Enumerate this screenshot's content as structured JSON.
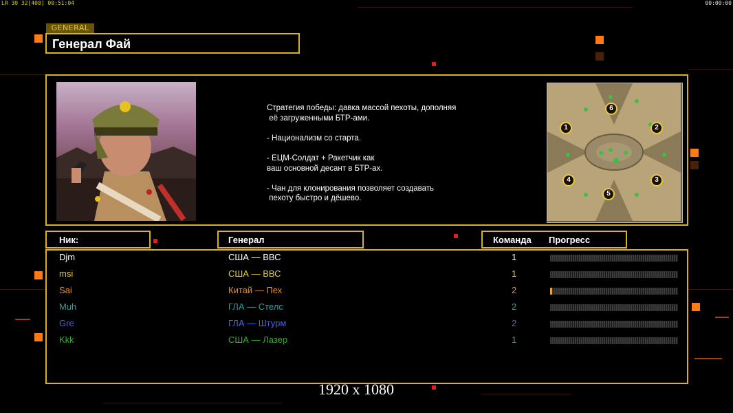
{
  "hud": {
    "left_stats": "LR 30 32[400] 00:51:04",
    "right_time": "00:00:00"
  },
  "general_tag": "GENERAL",
  "title": "Генерал Фай",
  "description": "Стратегия победы: давка массой пехоты, дополняя\n её загруженными БТР-ами.\n\n- Национализм со старта.\n\n- ЕЦМ-Солдат + Ракетчик как\nваш основной десант в БТР-ах.\n\n- Чан для клонирования позволяет создавать\n пехоту быстро и дёшево.",
  "minimap": {
    "markers": [
      "1",
      "2",
      "3",
      "4",
      "5",
      "6"
    ]
  },
  "columns": {
    "nick": "Ник:",
    "general": "Генерал",
    "team": "Команда",
    "progress": "Прогресс"
  },
  "players": [
    {
      "nick": "Djm",
      "general": "США — ВВС",
      "team": "1",
      "progress": 0,
      "color": "#ffffff"
    },
    {
      "nick": "msi",
      "general": "США — ВВС",
      "team": "1",
      "progress": 0,
      "color": "#e8d020"
    },
    {
      "nick": "Sai",
      "general": "Китай — Пех",
      "team": "2",
      "progress": 0.015,
      "color": "#f08c2c"
    },
    {
      "nick": "Muh",
      "general": "ГЛА — Стелс",
      "team": "2",
      "progress": 0,
      "color": "#2aa0a0"
    },
    {
      "nick": "Gre",
      "general": "ГЛА — Штурм",
      "team": "2",
      "progress": 0,
      "color": "#4a62e8"
    },
    {
      "nick": "Kkk",
      "general": "США — Лазер",
      "team": "1",
      "progress": 0,
      "color": "#30b030"
    }
  ],
  "resolution_label": "1920 x 1080"
}
